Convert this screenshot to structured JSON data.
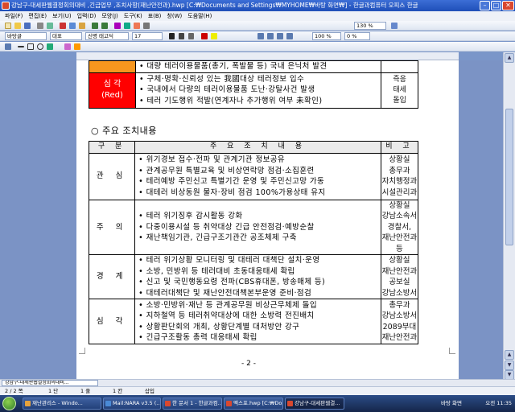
{
  "titlebar": {
    "title": "강남구-대세판웹결정회의대비 ,긴급업무 ,조치사항(재난안전과).hwp [C:₩Documents and Settings₩MYHOME₩바탕 화면₩] - 한글과컴퓨터 오피스 한글"
  },
  "menubar": {
    "items": [
      "파일(F)",
      "편집(E)",
      "보기(U)",
      "입력(D)",
      "모양(J)",
      "도구(K)",
      "표(B)",
      "창(W)",
      "도움말(H)"
    ]
  },
  "toolbar": {
    "zoom": "130 %",
    "style": "바탕글",
    "font_lang": "대표",
    "font": "신명 태고딕",
    "size": "17",
    "ratio": "100 %",
    "spacing": "0 %"
  },
  "table1": {
    "top_row": {
      "text": "대량 테러이용물품(총기, 폭발물 등) 국내 은닉처 발견"
    },
    "critical": {
      "label1": "심  각",
      "label2": "(Red)",
      "bullets": [
        "구체·명확·신뢰성 있는 我國대상 테러정보 입수",
        "국내에서 다량의 테러이용물품 도난·강탈사건 발생",
        "테러 기도행위 적발(연계자나 추가행위 여부 未확인)"
      ],
      "right": [
        "즉응",
        "태세",
        "돌입"
      ]
    },
    "colors": {
      "critical": "#ff0000",
      "orange": "#f7961e"
    }
  },
  "section": {
    "title": "○  주요 조치내용"
  },
  "table2": {
    "headers": [
      "구 분",
      "주 요 조 치 내 용",
      "비 고"
    ],
    "rows": [
      {
        "category": "관  심",
        "bullets": [
          "위기경보 접수·전파 및 관계기관 정보공유",
          "관계공무원 특별교육 및 비상연락망 점검·소집훈련",
          "테러예방 주민신고 특별기간 운영 및 주민신고망 가동",
          "대테러 비상동원 물자·장비 점검 100%가용상태 유지"
        ],
        "note": [
          "상황실",
          "총무과",
          "자치행정과",
          "시설관리과"
        ]
      },
      {
        "category": "주  의",
        "bullets": [
          "테러 위기징후 감시활동 강화",
          "다중이용시설 등 취약대상 긴급 안전점검·예방순찰",
          "재난책임기관, 긴급구조기관간 공조체제 구축"
        ],
        "note": [
          "상황실",
          "강남소속서",
          "경찰서,",
          "재난안전과",
          "등"
        ]
      },
      {
        "category": "경  계",
        "bullets": [
          "테러 위기상황 모니터링 및 대테러 대책단 설치·운영",
          "소방, 민방위 등 테러대비 초동대응태세 확립",
          "신고 및 국민행동요령 전파(CBS휴대폰, 방송매체 등)",
          "대테러대책단 및 재난안전대책본부운영 준비·점검"
        ],
        "note": [
          "상황실",
          "재난안전과",
          "공보실",
          "강남소방서"
        ]
      },
      {
        "category": "심  각",
        "bullets": [
          "소방·민방위·재난 등 관계공무원 비상근무체제 돌입",
          "지하철역 등 테러취약대상에 대한 소방력 전진배치",
          "상황판단회의 개최, 상황단계별 대처방안 강구",
          "긴급구조활동 총력 대응태세 확립"
        ],
        "note": [
          "총무과",
          "강남소방서",
          "2089부대",
          "재난안전과"
        ]
      }
    ]
  },
  "page_number": "- 2 -",
  "doc_tab": "강남구-대세판웹결정회의대비...",
  "status": {
    "page": "2 / 2 쪽",
    "section": "1 단",
    "line": "1 줄",
    "col": "1 칸",
    "mode": "삽입"
  },
  "taskbar": {
    "items": [
      "재난관리스 - Windo...",
      "Mail:NARA v3.5 (...",
      "한 문서 1 - 한글과컴...",
      "엑스포.hwp [C:₩Do...",
      "강남구-대세판웹결..."
    ],
    "tray_text": "바탕 화면",
    "clock": "오전 11:35"
  }
}
